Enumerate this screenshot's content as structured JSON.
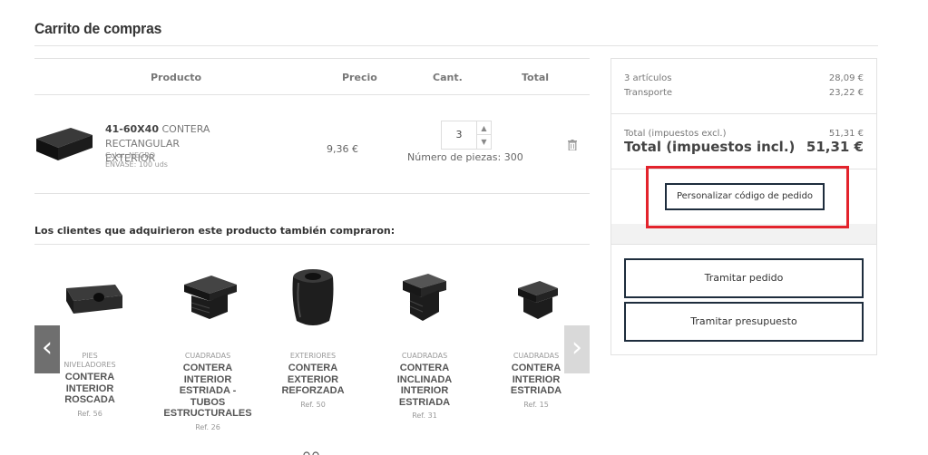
{
  "page": {
    "title": "Carrito de compras"
  },
  "cart": {
    "headers": {
      "product": "Producto",
      "price": "Precio",
      "qty": "Cant.",
      "total": "Total"
    },
    "item": {
      "code": "41-60X40",
      "name_line1": "CONTERA RECTANGULAR",
      "name_line2": "EXTERIOR",
      "color": "Color: NEGRO",
      "pack": "ENVASE: 100 uds",
      "price": "9,36 €",
      "qty": "3",
      "pieces": "Número de piezas: 300"
    }
  },
  "related": {
    "title": "Los clientes que adquirieron este producto también compraron:",
    "items": [
      {
        "category_line1": "PIES",
        "category_line2": "NIVELADORES",
        "name": [
          "CONTERA",
          "INTERIOR",
          "ROSCADA"
        ],
        "ref": "Ref. 56"
      },
      {
        "category_line1": "CUADRADAS",
        "category_line2": "",
        "name": [
          "CONTERA",
          "INTERIOR",
          "ESTRIADA -",
          "TUBOS",
          "ESTRUCTURALES"
        ],
        "ref": "Ref. 26"
      },
      {
        "category_line1": "EXTERIORES",
        "category_line2": "",
        "name": [
          "CONTERA",
          "EXTERIOR",
          "REFORZADA"
        ],
        "ref": "Ref. 50"
      },
      {
        "category_line1": "CUADRADAS",
        "category_line2": "",
        "name": [
          "CONTERA",
          "INCLINADA",
          "INTERIOR",
          "ESTRIADA"
        ],
        "ref": "Ref. 31"
      },
      {
        "category_line1": "CUADRADAS",
        "category_line2": "",
        "name": [
          "CONTERA",
          "INTERIOR",
          "ESTRIADA"
        ],
        "ref": "Ref. 15"
      }
    ]
  },
  "summary": {
    "items_label": "3 artículos",
    "items_value": "28,09 €",
    "shipping_label": "Transporte",
    "shipping_value": "23,22 €",
    "total_excl_label": "Total (impuestos excl.)",
    "total_excl_value": "51,31 €",
    "total_incl_label": "Total (impuestos incl.)",
    "total_incl_value": "51,31 €",
    "custom_code_button": "Personalizar código de pedido",
    "checkout_button": "Tramitar pedido",
    "quote_button": "Tramitar presupuesto"
  },
  "colors": {
    "button_border": "#1e2d3d",
    "highlight": "#e3232c",
    "arrow_active": "#6f6f6f",
    "arrow_inactive": "#d9d9d9"
  }
}
